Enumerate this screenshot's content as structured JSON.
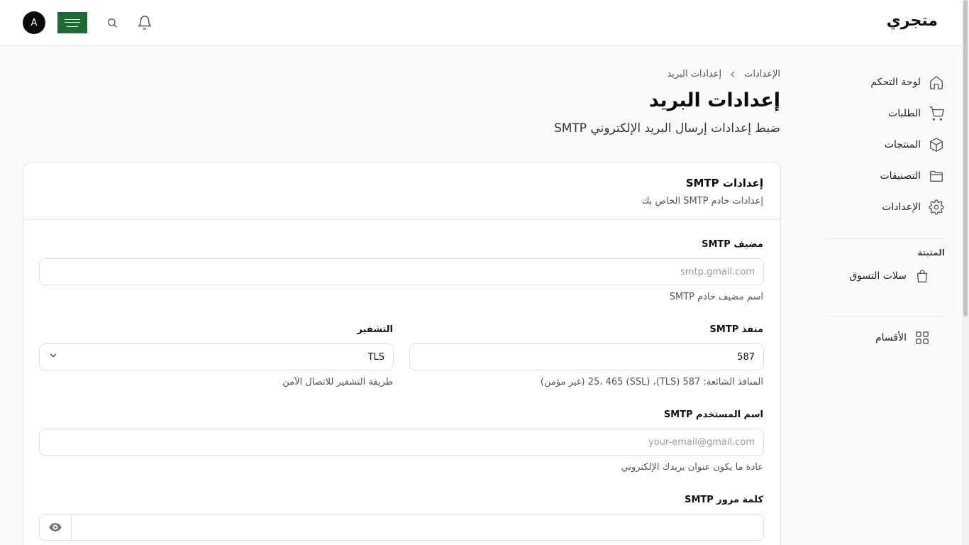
{
  "header": {
    "brand": "متجري",
    "avatar_initial": "A",
    "flag_icon": "saudi-flag-icon"
  },
  "sidebar": {
    "items": [
      {
        "label": "لوحة التحكم",
        "icon": "home-icon"
      },
      {
        "label": "الطلبات",
        "icon": "cart-icon"
      },
      {
        "label": "المنتجات",
        "icon": "box-icon"
      },
      {
        "label": "التصنيفات",
        "icon": "folder-icon"
      },
      {
        "label": "الإعدادات",
        "icon": "gear-icon"
      }
    ],
    "pinned_heading": "المثبتة",
    "pinned_items": [
      {
        "label": "سلات التسوق",
        "icon": "shopping-bag-icon"
      }
    ],
    "sections_label": "الأقسام"
  },
  "breadcrumb": {
    "parent": "الإعدادات",
    "current": "إعدادات البريد"
  },
  "page": {
    "title": "إعدادات البريد",
    "subtitle": "ضبط إعدادات إرسال البريد الإلكتروني SMTP"
  },
  "card": {
    "title": "إعدادات SMTP",
    "description": "إعدادات خادم SMTP الخاص بك"
  },
  "form": {
    "host": {
      "label": "مضيف SMTP",
      "placeholder": "smtp.gmail.com",
      "value": "",
      "hint": "اسم مضيف خادم SMTP"
    },
    "port": {
      "label": "منفذ SMTP",
      "value": "587",
      "hint": "المنافذ الشائعة: 587 (TLS)، 25، 465 (SSL) (غير مؤمن)"
    },
    "encryption": {
      "label": "التشفير",
      "value": "TLS",
      "hint": "طريقة التشفير للاتصال الآمن"
    },
    "username": {
      "label": "اسم المستخدم SMTP",
      "placeholder": "your-email@gmail.com",
      "value": "",
      "hint": "عادة ما يكون عنوان بريدك الإلكتروني"
    },
    "password": {
      "label": "كلمة مرور SMTP",
      "value": ""
    }
  },
  "colors": {
    "accent": "#0a0a0a",
    "border": "#e5e5e5",
    "flag_green": "#1b6b33"
  }
}
